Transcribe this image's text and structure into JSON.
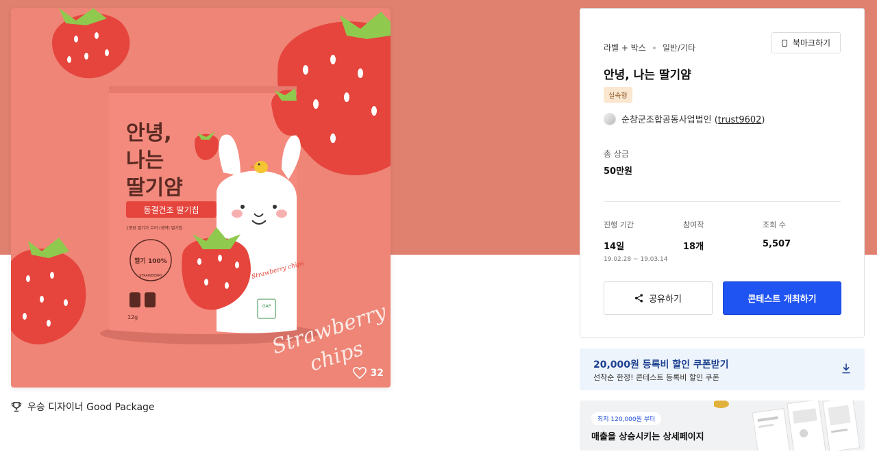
{
  "colors": {
    "hero_band": "#e0806f",
    "primary_button": "#1f53f2",
    "coupon_bg": "#eef4fc",
    "coupon_text": "#1b3f8f",
    "badge_bg": "#fbe6cf"
  },
  "gallery": {
    "package": {
      "title_line1": "안녕,",
      "title_line2": "나는",
      "title_line3": "딸기얌",
      "subtitle": "동결건조 딸기칩",
      "description": "1봉당 딸기가 무려 (생략) 딸기칩",
      "seal_text": "딸기 100%",
      "seal_ring": "STRAWBERRY",
      "weight": "12g",
      "strawberry_label": "Strawberry chips",
      "gap_label": "GAP",
      "big_text_1": "Strawberry",
      "big_text_2": "chips"
    },
    "like_count": "32",
    "award_text": "우승 디자이너 Good Package"
  },
  "info": {
    "category": "라벨 + 박스",
    "subcategory": "일반/기타",
    "bookmark_label": "북마크하기",
    "title": "안녕, 나는 딸기얌",
    "type_badge": "실속형",
    "host_name": "순창군조합공동사업법인 (",
    "host_id": "trust9602",
    "host_close": ")",
    "prize_label": "총 상금",
    "prize_value": "50만원",
    "stats": [
      {
        "label": "진행 기간",
        "value": "14일",
        "sub": "19.02.28 ~ 19.03.14"
      },
      {
        "label": "참여작",
        "value": "18개",
        "sub": ""
      },
      {
        "label": "조회 수",
        "value": "5,507",
        "sub": ""
      }
    ],
    "share_label": "공유하기",
    "open_contest_label": "콘테스트 개최하기"
  },
  "coupon": {
    "title": "20,000원 등록비 할인 쿠폰받기",
    "subtitle": "선착순 한정! 콘테스트 등록비 할인 쿠폰"
  },
  "ad": {
    "pill": "최저 120,000원 부터",
    "title": "매출을 상승시키는 상세페이지"
  }
}
